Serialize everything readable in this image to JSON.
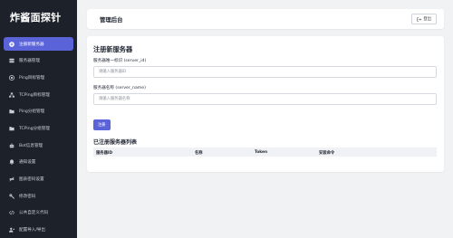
{
  "sidebar": {
    "brand": "炸酱面探针",
    "items": [
      {
        "label": "注册新服务器",
        "icon": "plus-circle-icon",
        "active": true
      },
      {
        "label": "服务器管理",
        "icon": "server-icon",
        "active": false
      },
      {
        "label": "Ping目标管理",
        "icon": "bullseye-icon",
        "active": false
      },
      {
        "label": "TCPing目标管理",
        "icon": "network-icon",
        "active": false
      },
      {
        "label": "Ping分组管理",
        "icon": "folder-icon",
        "active": false
      },
      {
        "label": "TCPing分组管理",
        "icon": "folder-icon",
        "active": false
      },
      {
        "label": "Bot信息管理",
        "icon": "robot-icon",
        "active": false
      },
      {
        "label": "通知设置",
        "icon": "bell-icon",
        "active": false
      },
      {
        "label": "图表密码设置",
        "icon": "eye-slash-icon",
        "active": false
      },
      {
        "label": "修改密码",
        "icon": "key-icon",
        "active": false
      },
      {
        "label": "公共自定义代码",
        "icon": "code-icon",
        "active": false
      },
      {
        "label": "配置导入/导出",
        "icon": "user-import-icon",
        "active": false
      }
    ]
  },
  "header": {
    "title": "管理后台",
    "logout_label": "登出"
  },
  "register": {
    "title": "注册新服务器",
    "server_id_label": "服务器唯一标识 (server_id)",
    "server_id_placeholder": "请输入服务器ID",
    "server_name_label": "服务器名称 (server_name)",
    "server_name_placeholder": "请输入服务器名称",
    "submit_label": "注册"
  },
  "server_list": {
    "title": "已注册服务器列表",
    "columns": [
      "服务器ID",
      "名称",
      "Token",
      "安装命令"
    ]
  },
  "colors": {
    "accent": "#5b63d9",
    "sidebar_bg": "#1d212a",
    "page_bg": "#f1f2f4"
  }
}
